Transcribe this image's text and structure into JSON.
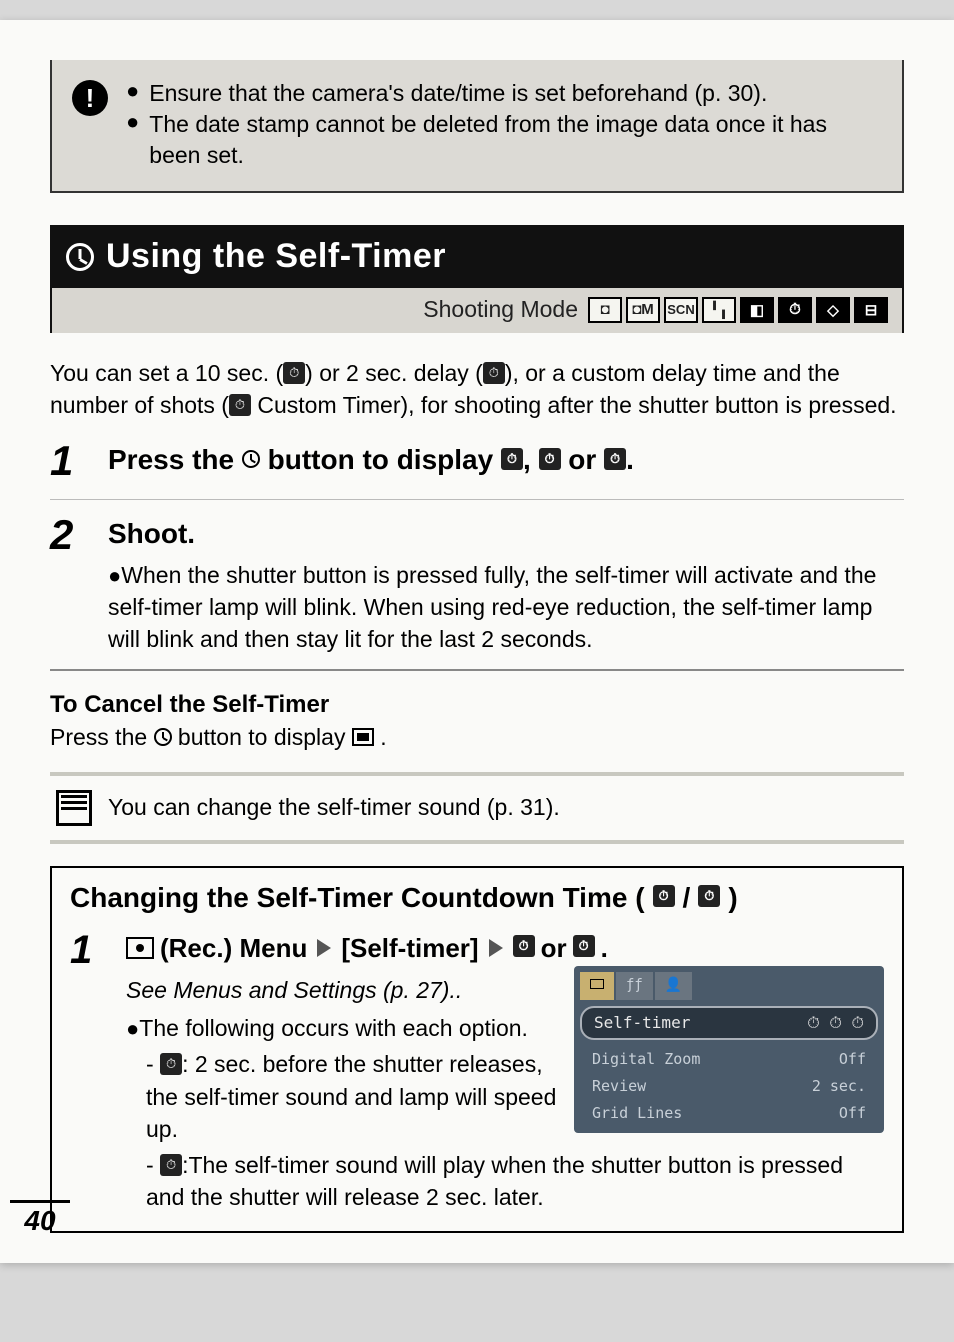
{
  "warning": {
    "b1": "Ensure that the camera's date/time is set beforehand (p. 30).",
    "b2": "The date stamp cannot be deleted from the image data once it has been set."
  },
  "section": {
    "title": "Using the Self-Timer",
    "mode_label": "Shooting Mode",
    "modes": [
      "📷",
      "🅼",
      "SCN",
      "▀",
      "▙",
      "⏱",
      "◇",
      "⊟"
    ]
  },
  "intro": {
    "p1a": "You can set a 10 sec. (",
    "p1b": ") or 2 sec. delay (",
    "p1c": "), or a custom delay time and the number of shots (",
    "p1d": " Custom Timer), for shooting after the shutter button is pressed."
  },
  "steps": {
    "s1_pre": "Press the ",
    "s1_mid": " button to display ",
    "s1_sep": ", ",
    "s1_or": " or ",
    "s1_end": ".",
    "s2_h": "Shoot.",
    "s2_body": "When the shutter button is pressed fully, the self-timer will activate and the self-timer lamp will blink. When using red-eye reduction, the self-timer lamp will blink and then stay lit for the last 2 seconds."
  },
  "cancel": {
    "h": "To Cancel the Self-Timer",
    "t_pre": "Press the ",
    "t_mid": " button to display ",
    "t_end": " ."
  },
  "hint": "You can change the self-timer sound (p. 31).",
  "subsection": {
    "title_pre": "Changing the Self-Timer Countdown Time (",
    "title_sep": "/",
    "title_end": ")",
    "step_pre": "(Rec.) Menu",
    "step_mid": "[Self-timer]",
    "step_or": " or ",
    "step_end": ".",
    "see": "See Menus and Settings (p. 27)..",
    "b1": "The following occurs with each option.",
    "opt10": ": 2 sec. before the shutter releases, the self-timer sound and lamp will speed up.",
    "opt2": ":The self-timer sound will play when the shutter button is pressed and the shutter will release 2 sec. later."
  },
  "screen": {
    "sel_label": "Self-timer",
    "r1": {
      "k": "Digital Zoom",
      "v": "Off"
    },
    "r2": {
      "k": "Review",
      "v": "2 sec."
    },
    "r3": {
      "k": "Grid Lines",
      "v": "Off"
    }
  },
  "page_number": "40"
}
